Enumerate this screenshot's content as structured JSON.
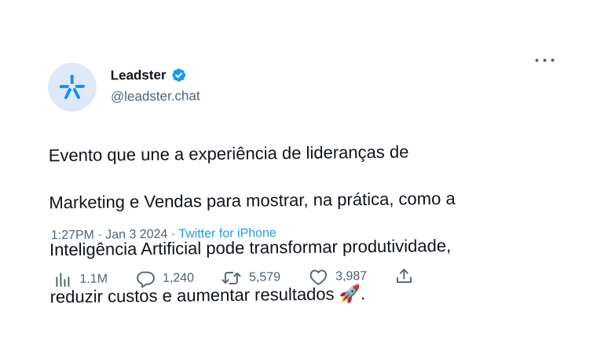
{
  "author": {
    "name": "Leadster",
    "handle": "@leadster.chat",
    "verified": true
  },
  "tweet": {
    "lines": [
      "Evento que une a experiência de lideranças de",
      "Marketing e Vendas para mostrar, na prática, como a",
      "Inteligência Artificial pode transformar produtividade,",
      "reduzir custos e aumentar resultados 🚀."
    ]
  },
  "meta": {
    "time": "1:27PM",
    "separator1": " · ",
    "date": "Jan 3 2024",
    "separator2": " · ",
    "source": "Twitter for iPhone"
  },
  "actions": {
    "views": "1.1M",
    "replies": "1,240",
    "retweets": "5,579",
    "likes": "3,987"
  },
  "icons": {
    "avatar": "leadster-logo-icon",
    "verified": "verified-badge-icon",
    "more": "more-options-icon",
    "views": "views-icon",
    "replies": "reply-icon",
    "retweets": "retweet-icon",
    "likes": "like-icon",
    "share": "share-icon"
  },
  "colors": {
    "accent": "#1d9bf0",
    "text": "#0f1419",
    "muted": "#536471",
    "avatar_bg": "#dde9f8",
    "logo": "#1a8ff0"
  }
}
